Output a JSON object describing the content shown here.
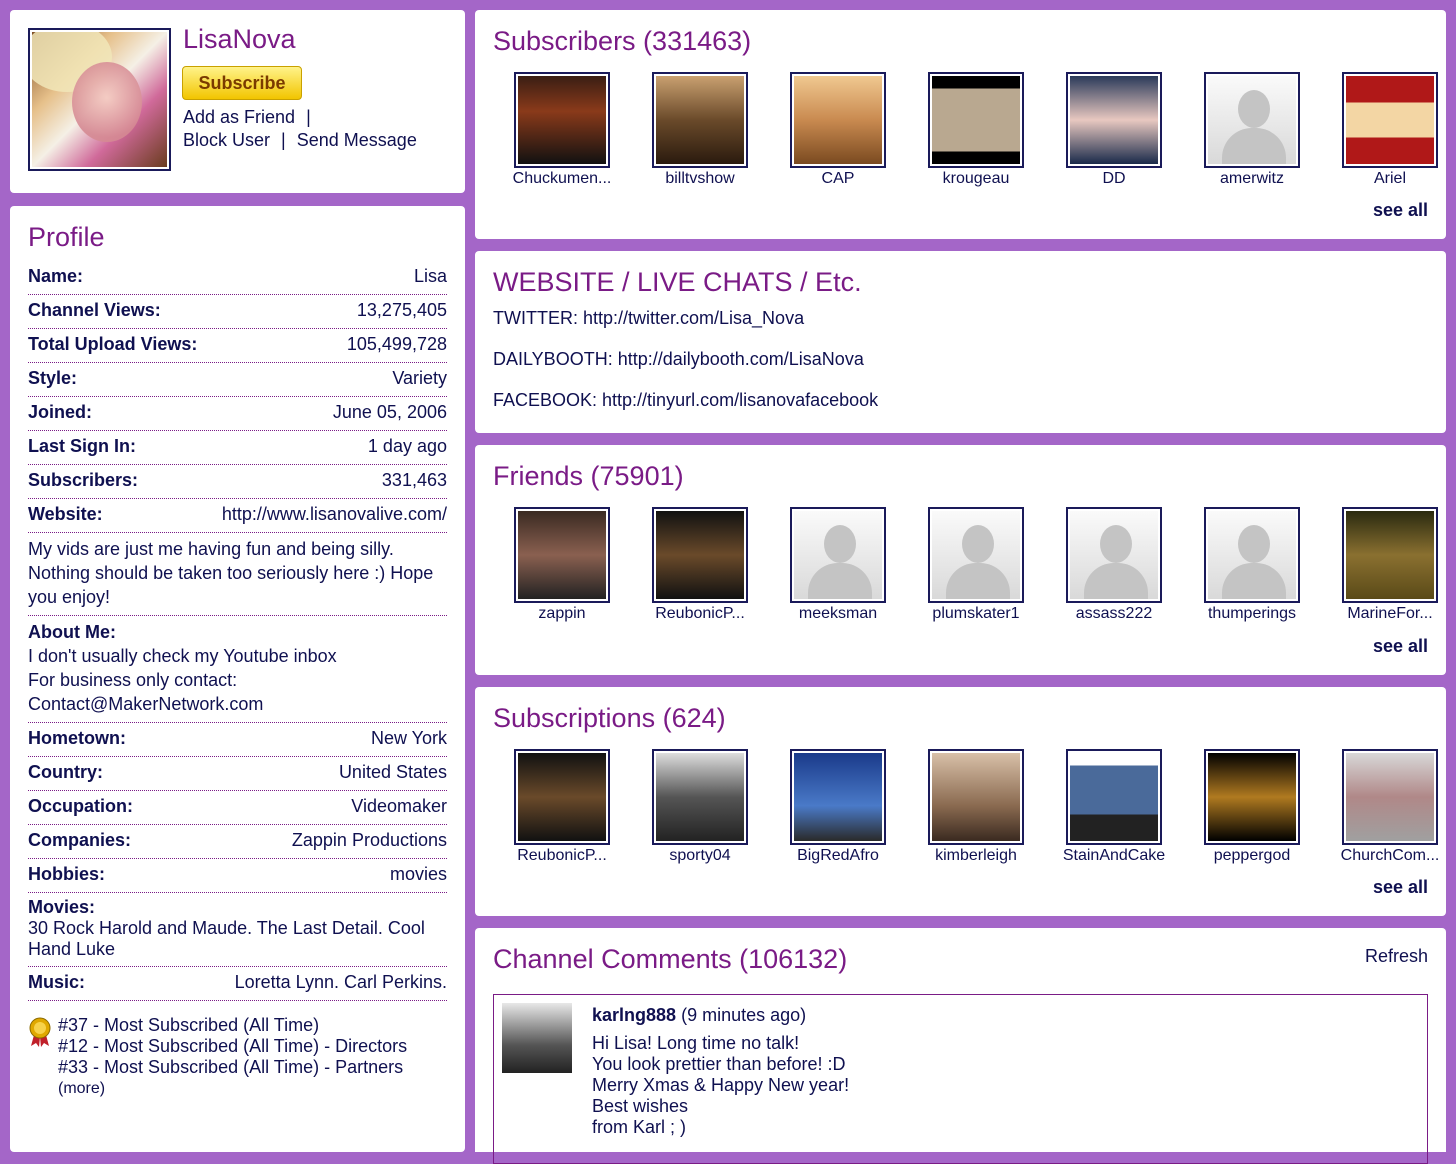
{
  "header": {
    "username": "LisaNova",
    "subscribe_label": "Subscribe",
    "add_friend": "Add as Friend",
    "pipe": "|",
    "block_user": "Block User",
    "send_message": "Send Message"
  },
  "profile": {
    "title": "Profile",
    "fields": [
      {
        "k": "Name:",
        "v": "Lisa"
      },
      {
        "k": "Channel Views:",
        "v": "13,275,405"
      },
      {
        "k": "Total Upload Views:",
        "v": "105,499,728"
      },
      {
        "k": "Style:",
        "v": "Variety"
      },
      {
        "k": "Joined:",
        "v": "June 05, 2006"
      },
      {
        "k": "Last Sign In:",
        "v": "1 day ago"
      },
      {
        "k": "Subscribers:",
        "v": "331,463"
      },
      {
        "k": "Website:",
        "v": "http://www.lisanovalive.com/"
      }
    ],
    "bio": "My vids are just me having fun and being silly. Nothing should be taken too seriously here :) Hope you enjoy!",
    "about_label": "About Me:",
    "about_lines": [
      "I don't usually check my Youtube inbox",
      "For business only contact:",
      "Contact@MakerNetwork.com"
    ],
    "fields2": [
      {
        "k": "Hometown:",
        "v": "New York"
      },
      {
        "k": "Country:",
        "v": "United States"
      },
      {
        "k": "Occupation:",
        "v": "Videomaker"
      },
      {
        "k": "Companies:",
        "v": "Zappin Productions"
      },
      {
        "k": "Hobbies:",
        "v": "movies"
      }
    ],
    "movies_label": "Movies:",
    "movies": "30 Rock Harold and Maude. The Last Detail. Cool Hand Luke",
    "music_label": "Music:",
    "music": "Loretta Lynn. Carl Perkins.",
    "awards": [
      "#37 - Most Subscribed (All Time)",
      "#12 - Most Subscribed (All Time) - Directors",
      "#33 - Most Subscribed (All Time) - Partners"
    ],
    "awards_more": "(more)"
  },
  "subscribers": {
    "title": "Subscribers (331463)",
    "items": [
      "Chuckumen...",
      "billtvshow",
      "CAP",
      "krougeau",
      "DD",
      "amerwitz",
      "Ariel"
    ],
    "see_all": "see all"
  },
  "website": {
    "title": "WEBSITE / LIVE CHATS / Etc.",
    "lines": [
      "TWITTER: http://twitter.com/Lisa_Nova",
      "DAILYBOOTH: http://dailybooth.com/LisaNova",
      "FACEBOOK: http://tinyurl.com/lisanovafacebook"
    ]
  },
  "friends": {
    "title": "Friends (75901)",
    "items": [
      "zappin",
      "ReubonicP...",
      "meeksman",
      "plumskater1",
      "assass222",
      "thumperings",
      "MarineFor..."
    ],
    "see_all": "see all"
  },
  "subscriptions": {
    "title": "Subscriptions (624)",
    "items": [
      "ReubonicP...",
      "sporty04",
      "BigRedAfro",
      "kimberleigh",
      "StainAndCake",
      "peppergod",
      "ChurchCom..."
    ],
    "see_all": "see all"
  },
  "comments": {
    "title": "Channel Comments (106132)",
    "refresh": "Refresh",
    "first": {
      "author": "karlng888",
      "time": "(9 minutes ago)",
      "lines": [
        "Hi Lisa! Long time no talk!",
        "You look prettier than before! :D",
        "Merry Xmas & Happy New year!",
        "Best wishes",
        "from Karl ; )"
      ]
    }
  }
}
